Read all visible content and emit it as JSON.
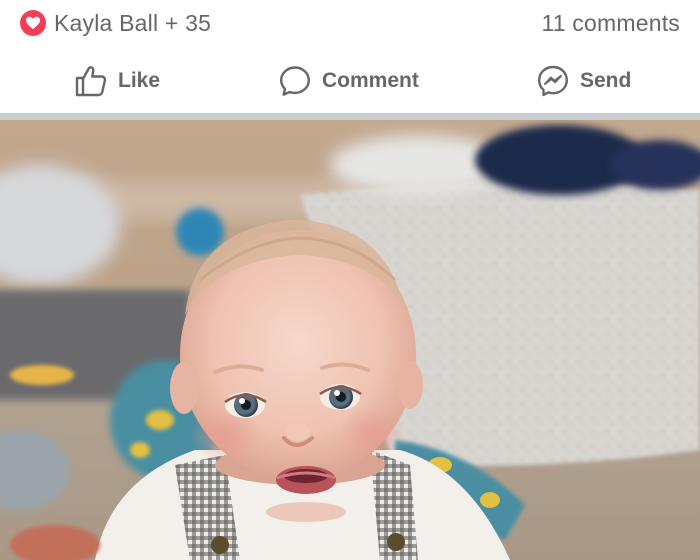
{
  "reactions": {
    "icon": "heart-icon",
    "color": "#f33e58",
    "text": "Kayla Ball + 35"
  },
  "comments": {
    "text": "11 comments"
  },
  "actions": {
    "like": {
      "label": "Like",
      "icon": "thumbs-up-icon"
    },
    "comment": {
      "label": "Comment",
      "icon": "comment-bubble-icon"
    },
    "send": {
      "label": "Send",
      "icon": "messenger-send-icon"
    }
  },
  "colors": {
    "secondary_text": "#65676b",
    "divider": "#c9ccd1",
    "love": "#f33e58"
  },
  "photo": {
    "subject": "baby-photo"
  }
}
